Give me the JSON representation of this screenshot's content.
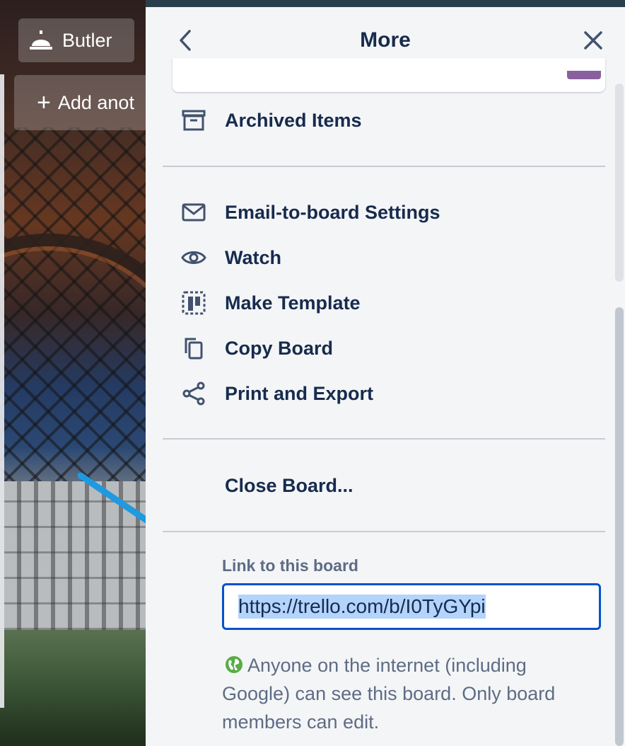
{
  "board": {
    "butler_label": "Butler",
    "add_list_label": "Add anot"
  },
  "panel": {
    "title": "More",
    "back_icon": "chevron-left-icon",
    "close_icon": "close-icon",
    "items_group1": [
      {
        "label": "Archived Items",
        "icon": "archive-icon"
      }
    ],
    "items_group2": [
      {
        "label": "Email-to-board Settings",
        "icon": "email-icon"
      },
      {
        "label": "Watch",
        "icon": "eye-icon"
      },
      {
        "label": "Make Template",
        "icon": "template-icon"
      },
      {
        "label": "Copy Board",
        "icon": "copy-icon"
      },
      {
        "label": "Print and Export",
        "icon": "share-icon"
      }
    ],
    "close_board_label": "Close Board...",
    "link_section": {
      "label": "Link to this board",
      "url": "https://trello.com/b/I0TyGYpi",
      "visibility_text": "Anyone on the internet (including Google) can see this board. Only board members can edit."
    }
  },
  "colors": {
    "panel_bg": "#f4f5f7",
    "text_primary": "#172b4d",
    "text_secondary": "#5e6c84",
    "input_border": "#0052cc",
    "selection": "#b3d4fc",
    "arrow": "#1f9ae0",
    "globe": "#5aac44"
  }
}
